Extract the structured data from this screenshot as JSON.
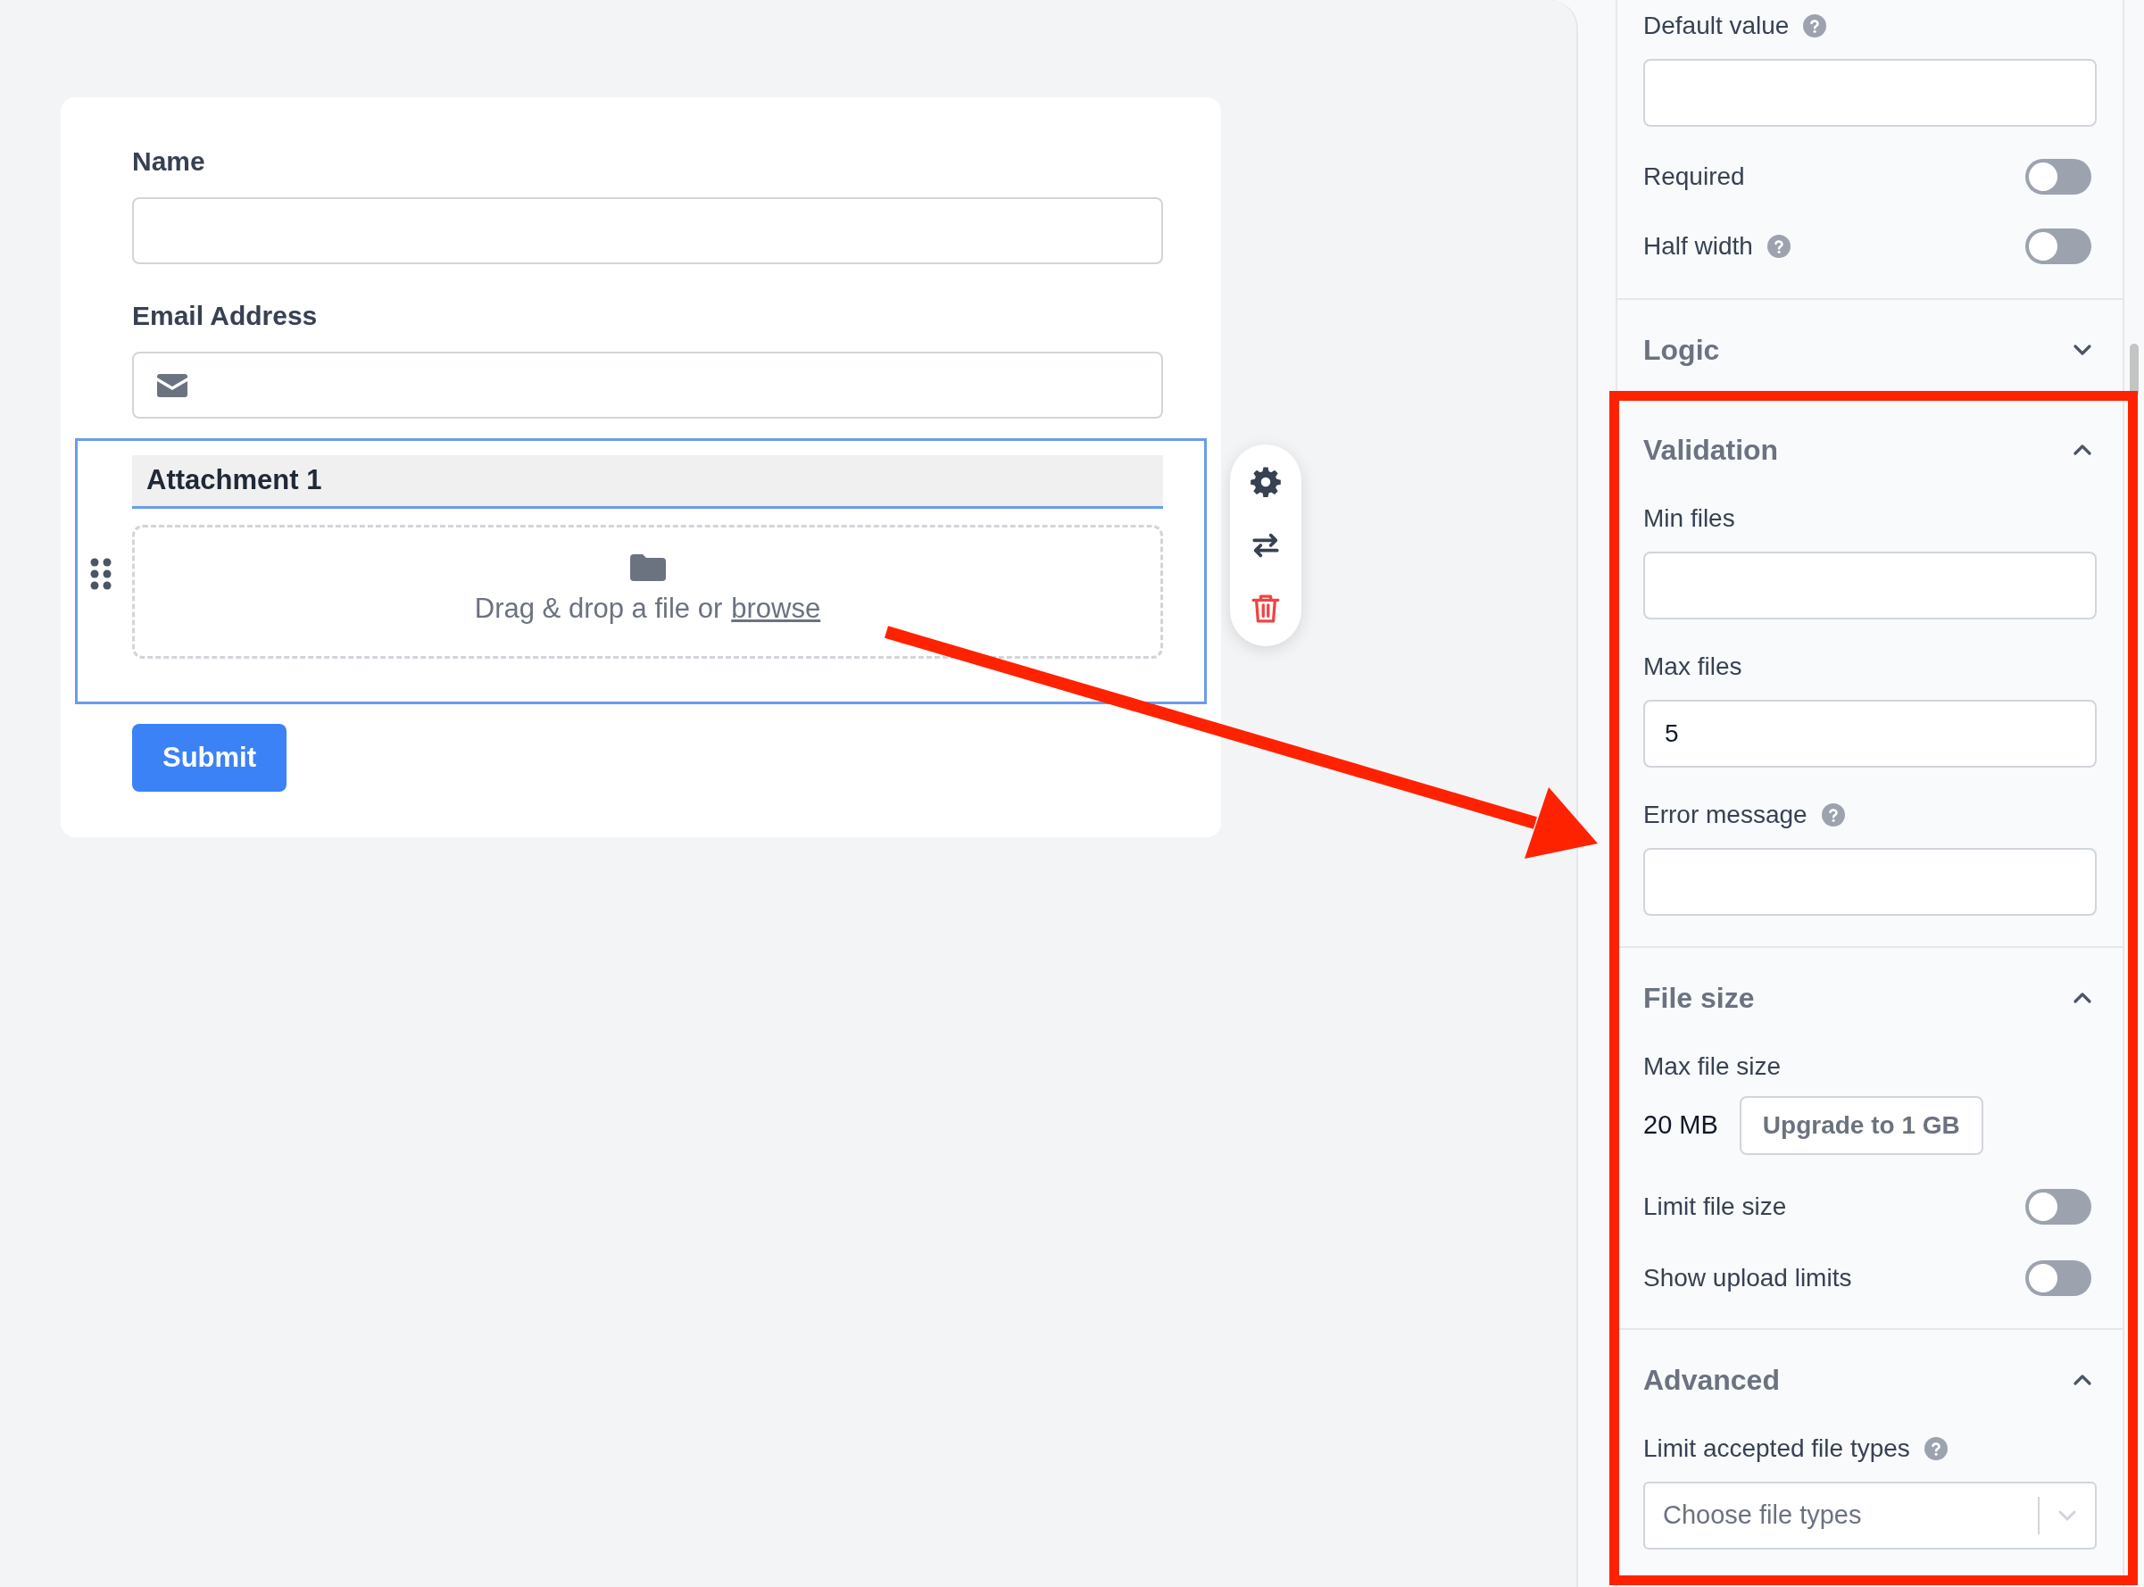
{
  "form": {
    "fields": [
      {
        "kind": "text",
        "label": "Name",
        "selected": false
      },
      {
        "kind": "email",
        "label": "Email Address",
        "selected": false
      },
      {
        "kind": "file",
        "label": "Attachment 1",
        "selected": true,
        "prompt": "Drag & drop a file or",
        "link": "browse"
      }
    ],
    "submit": "Submit"
  },
  "settings": {
    "items": [
      {
        "kind": "input",
        "label": "Default value",
        "help": true
      },
      {
        "kind": "toggle",
        "label": "Required",
        "help": false,
        "on": false
      },
      {
        "kind": "toggle",
        "label": "Half width",
        "help": true,
        "on": false
      }
    ],
    "sections": [
      {
        "title": "Logic",
        "expanded": false
      },
      {
        "title": "Validation",
        "expanded": true,
        "items": [
          {
            "kind": "input",
            "label": "Min files",
            "help": false
          },
          {
            "kind": "input",
            "label": "Max files",
            "help": false,
            "value": "5"
          },
          {
            "kind": "input",
            "label": "Error message",
            "help": true
          }
        ]
      },
      {
        "title": "File size",
        "expanded": true,
        "items": [
          {
            "kind": "size",
            "label": "Max file size",
            "help": false,
            "value": "20 MB",
            "button": "Upgrade to 1 GB"
          },
          {
            "kind": "toggle",
            "label": "Limit file size",
            "help": false,
            "on": false
          },
          {
            "kind": "toggle",
            "label": "Show upload limits",
            "help": false,
            "on": false
          }
        ]
      },
      {
        "title": "Advanced",
        "expanded": true,
        "items": [
          {
            "kind": "select",
            "label": "Limit accepted file types",
            "help": true,
            "placeholder": "Choose file types"
          }
        ]
      }
    ]
  }
}
